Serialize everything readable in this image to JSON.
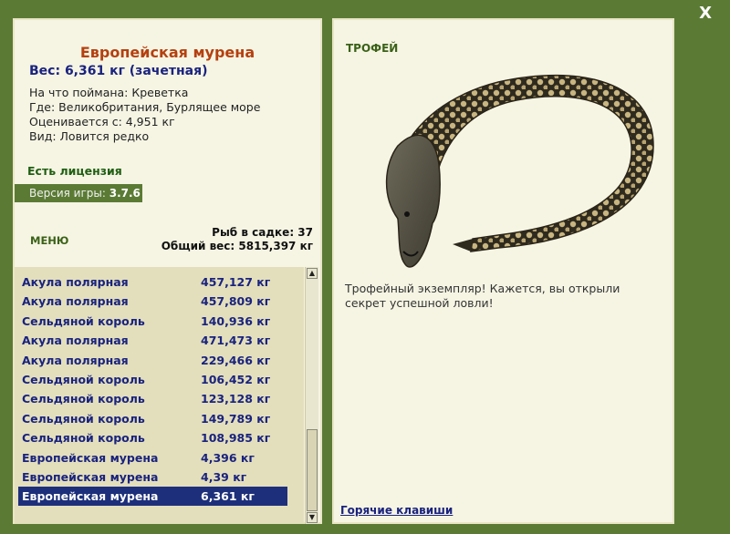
{
  "window": {
    "close_label": "X"
  },
  "fish": {
    "name": "Европейская мурена",
    "weight_line": "Вес: 6,361 кг (зачетная)",
    "caught_with": "На что поймана: Креветка",
    "location": "Где: Великобритания, Бурлящее море",
    "valued_from": "Оценивается с: 4,951 кг",
    "rarity": "Вид: Ловится редко"
  },
  "license": "Есть лицензия",
  "version": {
    "label": "Версия игры:",
    "value": "3.7.6"
  },
  "menu_label": "МЕНЮ",
  "cage": {
    "count_line": "Рыб в садке: 37",
    "total_line": "Общий вес: 5815,397 кг"
  },
  "catch_list": [
    {
      "name": "Акула полярная",
      "weight": "457,127 кг"
    },
    {
      "name": "Акула полярная",
      "weight": "457,809 кг"
    },
    {
      "name": "Сельдяной король",
      "weight": "140,936 кг"
    },
    {
      "name": "Акула полярная",
      "weight": "471,473 кг"
    },
    {
      "name": "Акула полярная",
      "weight": "229,466 кг"
    },
    {
      "name": "Сельдяной король",
      "weight": "106,452 кг"
    },
    {
      "name": "Сельдяной король",
      "weight": "123,128 кг"
    },
    {
      "name": "Сельдяной король",
      "weight": "149,789 кг"
    },
    {
      "name": "Сельдяной король",
      "weight": "108,985 кг"
    },
    {
      "name": "Европейская мурена",
      "weight": "4,396 кг"
    },
    {
      "name": "Европейская мурена",
      "weight": "4,39 кг"
    },
    {
      "name": "Европейская мурена",
      "weight": "6,361 кг"
    }
  ],
  "selected_index": 11,
  "trophy": {
    "label": "ТРОФЕЙ",
    "text": "Трофейный экземпляр! Кажется, вы открыли секрет успешной ловли!"
  },
  "hotkeys_label": "Горячие клавиши",
  "colors": {
    "frame": "#5b7b35",
    "panel": "#f6f5e4",
    "list_bg": "#e3dfbd",
    "selection": "#1d2f7a",
    "fish_name": "#b5400f",
    "link_text": "#1a237e"
  }
}
